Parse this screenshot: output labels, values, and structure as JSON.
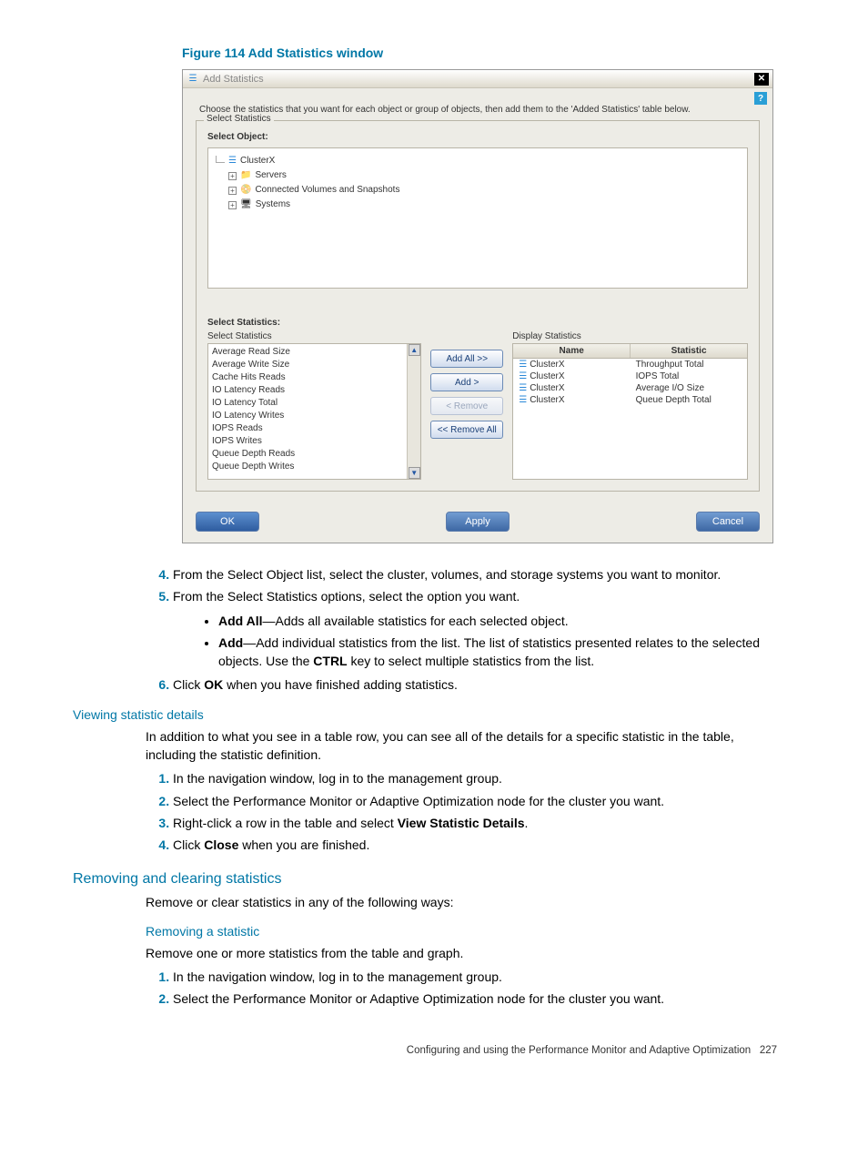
{
  "figure_caption": "Figure 114 Add Statistics window",
  "window": {
    "title": "Add Statistics",
    "close_glyph": "✕",
    "help_glyph": "?",
    "instruction": "Choose the statistics that you want for each object or group of objects, then add them to the 'Added Statistics' table below.",
    "select_statistics_legend": "Select Statistics",
    "select_object_label": "Select Object:",
    "tree": {
      "root": "ClusterX",
      "children": [
        "Servers",
        "Connected Volumes and Snapshots",
        "Systems"
      ]
    },
    "select_statistics_label": "Select Statistics:",
    "left_list_caption": "Select Statistics",
    "right_list_caption": "Display Statistics",
    "left_items": [
      "Average Read Size",
      "Average Write Size",
      "Cache Hits Reads",
      "IO Latency Reads",
      "IO Latency Total",
      "IO Latency Writes",
      "IOPS Reads",
      "IOPS Writes",
      "Queue Depth Reads",
      "Queue Depth Writes"
    ],
    "btns": {
      "add_all": "Add All >>",
      "add": "Add >",
      "remove": "< Remove",
      "remove_all": "<< Remove All"
    },
    "right_headers": {
      "name": "Name",
      "stat": "Statistic"
    },
    "right_rows": [
      {
        "name": "ClusterX",
        "stat": "Throughput Total"
      },
      {
        "name": "ClusterX",
        "stat": "IOPS Total"
      },
      {
        "name": "ClusterX",
        "stat": "Average I/O Size"
      },
      {
        "name": "ClusterX",
        "stat": "Queue Depth Total"
      }
    ],
    "ok": "OK",
    "apply": "Apply",
    "cancel": "Cancel"
  },
  "steps_a": {
    "s4": "From the Select Object list, select the cluster, volumes, and storage systems you want to monitor.",
    "s5": "From the Select Statistics options, select the option you want.",
    "s5a_b": "Add All",
    "s5a_t": "—Adds all available statistics for each selected object.",
    "s5b_b": "Add",
    "s5b_t1": "—Add individual statistics from the list. The list of statistics presented relates to the selected objects. Use the ",
    "s5b_ctrl": "CTRL",
    "s5b_t2": " key to select multiple statistics from the list.",
    "s6a": "Click ",
    "s6b": "OK",
    "s6c": " when you have finished adding statistics."
  },
  "viewing": {
    "heading": "Viewing statistic details",
    "intro": "In addition to what you see in a table row, you can see all of the details for a specific statistic in the table, including the statistic definition.",
    "s1": "In the navigation window, log in to the management group.",
    "s2": "Select the Performance Monitor or Adaptive Optimization node for the cluster you want.",
    "s3a": "Right-click a row in the table and select ",
    "s3b": "View Statistic Details",
    "s3c": ".",
    "s4a": "Click ",
    "s4b": "Close",
    "s4c": " when you are finished."
  },
  "removing": {
    "heading": "Removing and clearing statistics",
    "intro": "Remove or clear statistics in any of the following ways:",
    "sub": "Removing a statistic",
    "subintro": "Remove one or more statistics from the table and graph.",
    "s1": "In the navigation window, log in to the management group.",
    "s2": "Select the Performance Monitor or Adaptive Optimization node for the cluster you want."
  },
  "footer": {
    "text": "Configuring and using the Performance Monitor and Adaptive Optimization",
    "page": "227"
  }
}
